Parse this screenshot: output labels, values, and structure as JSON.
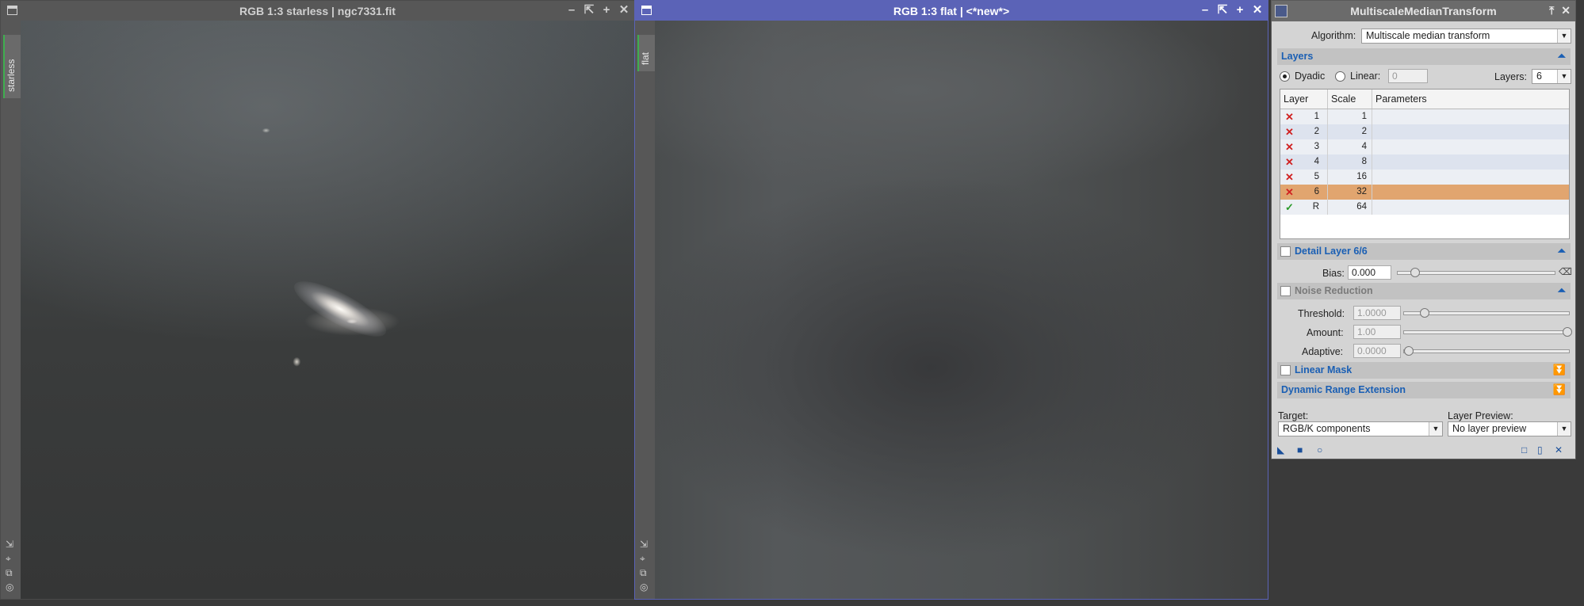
{
  "windows": {
    "left": {
      "title": "RGB 1:3 starless | ngc7331.fit",
      "tab": "starless",
      "controls": [
        "–",
        "⇱",
        "+",
        "✕"
      ],
      "side_icons": [
        "⇲",
        "⌖",
        "⧉",
        "◎"
      ]
    },
    "right": {
      "title": "RGB 1:3 flat | <*new*>",
      "tab": "flat",
      "controls": [
        "–",
        "⇱",
        "+",
        "✕"
      ],
      "side_icons": [
        "⇲",
        "⌖",
        "⧉",
        "◎"
      ]
    }
  },
  "process": {
    "title": "MultiscaleMedianTransform",
    "title_controls": [
      "✕",
      "✕"
    ],
    "algorithm_label": "Algorithm:",
    "algorithm_value": "Multiscale median transform",
    "layers_section": "Layers",
    "dyadic_label": "Dyadic",
    "linear_label": "Linear:",
    "linear_value": "0",
    "layers_label": "Layers:",
    "layers_value": "6",
    "table": {
      "headers": [
        "Layer",
        "Scale",
        "Parameters"
      ],
      "rows": [
        {
          "mark": "✕",
          "layer": "1",
          "scale": "1"
        },
        {
          "mark": "✕",
          "layer": "2",
          "scale": "2"
        },
        {
          "mark": "✕",
          "layer": "3",
          "scale": "4"
        },
        {
          "mark": "✕",
          "layer": "4",
          "scale": "8"
        },
        {
          "mark": "✕",
          "layer": "5",
          "scale": "16"
        },
        {
          "mark": "✕",
          "layer": "6",
          "scale": "32"
        },
        {
          "mark": "✓",
          "layer": "R",
          "scale": "64"
        }
      ]
    },
    "detail_section": "Detail Layer 6/6",
    "bias_label": "Bias:",
    "bias_value": "0.000",
    "noise_section": "Noise Reduction",
    "threshold_label": "Threshold:",
    "threshold_value": "1.0000",
    "amount_label": "Amount:",
    "amount_value": "1.00",
    "adaptive_label": "Adaptive:",
    "adaptive_value": "0.0000",
    "linear_mask_section": "Linear Mask",
    "dre_section": "Dynamic Range Extension",
    "target_label": "Target:",
    "target_value": "RGB/K components",
    "layer_preview_label": "Layer Preview:",
    "layer_preview_value": "No layer preview"
  },
  "colors": {
    "active_title": "#5b63b7",
    "selected_row": "#e1a56f",
    "section_title": "#1a5fb4"
  }
}
